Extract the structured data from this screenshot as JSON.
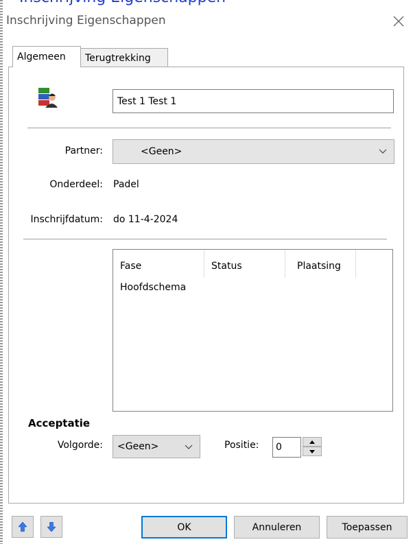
{
  "clipped_header_text": "Inschrijving Eigenschappen",
  "window": {
    "title": "Inschrijving Eigenschappen"
  },
  "tabs": [
    {
      "label": "Algemeen",
      "active": true
    },
    {
      "label": "Terugtrekking",
      "active": false
    }
  ],
  "general": {
    "name_value": "Test 1 Test 1",
    "partner_label": "Partner:",
    "partner_value": "<Geen>",
    "onderdeel_label": "Onderdeel:",
    "onderdeel_value": "Padel",
    "datum_label": "Inschrijfdatum:",
    "datum_value": "do 11-4-2024"
  },
  "phase_table": {
    "columns": [
      "Fase",
      "Status",
      "Plaatsing"
    ],
    "rows": [
      [
        "Hoofdschema",
        "",
        ""
      ]
    ]
  },
  "acceptatie": {
    "heading": "Acceptatie",
    "volgorde_label": "Volgorde:",
    "volgorde_value": "<Geen>",
    "positie_label": "Positie:",
    "positie_value": "0"
  },
  "buttons": {
    "ok": "OK",
    "cancel": "Annuleren",
    "apply": "Toepassen"
  },
  "colors": {
    "accent": "#0078d7",
    "header_text": "#1f3fc8"
  },
  "icons": {
    "entry": "registration-person-icon",
    "move_up": "arrow-up-icon",
    "move_down": "arrow-down-icon"
  }
}
